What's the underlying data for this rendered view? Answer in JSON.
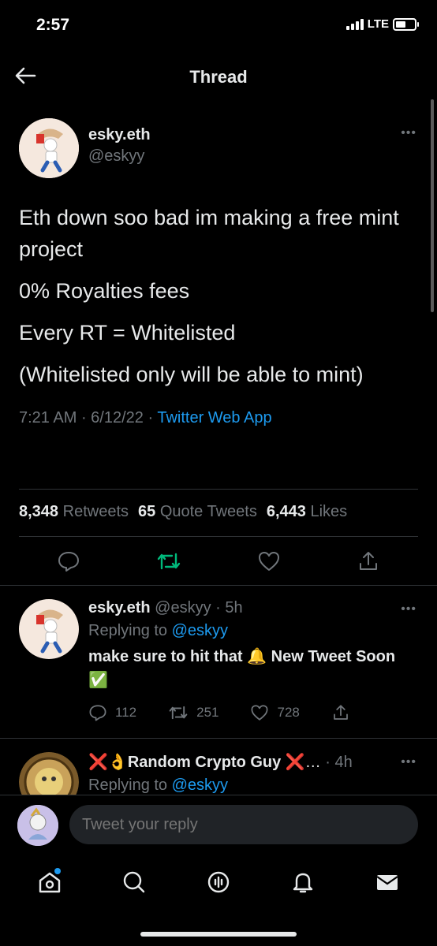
{
  "status_bar": {
    "time": "2:57",
    "network": "LTE"
  },
  "header": {
    "title": "Thread"
  },
  "main_tweet": {
    "name": "esky.eth",
    "handle": "@eskyy",
    "lines": [
      "Eth down soo bad im making a free mint project",
      "0% Royalties fees",
      "Every RT = Whitelisted",
      "(Whitelisted only will be able to mint)"
    ],
    "time": "7:21 AM",
    "date": "6/12/22",
    "source": "Twitter Web App",
    "retweets_count": "8,348",
    "retweets_label": "Retweets",
    "quotes_count": "65",
    "quotes_label": "Quote Tweets",
    "likes_count": "6,443",
    "likes_label": "Likes"
  },
  "replies": [
    {
      "name": "esky.eth",
      "handle": "@eskyy",
      "time": "5h",
      "replying_label": "Replying to",
      "replying_to": "@eskyy",
      "text_1": "make sure to hit that",
      "emoji_bell": "🔔",
      "text_2": "New Tweet Soon",
      "emoji_check": "✅",
      "reply_count": "112",
      "retweet_count": "251",
      "like_count": "728"
    },
    {
      "name_prefix": "❌👌",
      "name": "Random Crypto Guy",
      "name_suffix": "❌…",
      "time": "4h",
      "replying_label": "Replying to",
      "replying_to": "@eskyy"
    }
  ],
  "composer": {
    "placeholder": "Tweet your reply"
  },
  "colors": {
    "accent": "#1d9bf0",
    "retweet_green": "#00ba7c",
    "muted": "#71767b"
  },
  "icons": {
    "back": "arrow-left-icon",
    "more": "more-horizontal-icon",
    "reply": "reply-bubble-icon",
    "retweet": "retweet-icon",
    "like": "heart-icon",
    "share": "share-icon",
    "tabs": [
      "home-icon",
      "search-icon",
      "spaces-icon",
      "notifications-icon",
      "messages-icon"
    ]
  }
}
